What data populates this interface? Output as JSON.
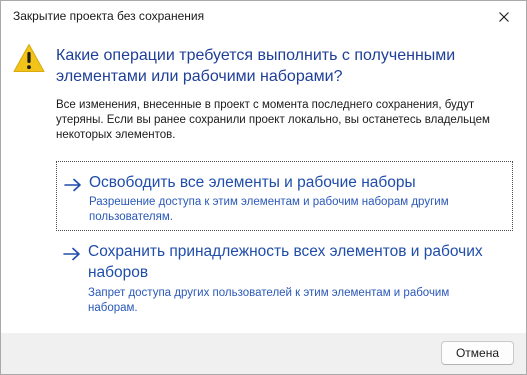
{
  "window": {
    "title": "Закрытие проекта без сохранения",
    "close_icon": "close-icon"
  },
  "dialog": {
    "icon": "warning-icon",
    "main_instruction": "Какие операции требуется выполнить с полученными элементами или рабочими наборами?",
    "content": "Все изменения, внесенные в проект с момента последнего сохранения, будут утеряны. Если вы ранее сохранили проект локально, вы останетесь владельцем некоторых элементов."
  },
  "commands": [
    {
      "title": "Освободить все элементы и рабочие наборы",
      "note": "Разрешение доступа к этим элементам и рабочим наборам другим пользователям."
    },
    {
      "title": "Сохранить принадлежность всех элементов и рабочих наборов",
      "note": "Запрет доступа других пользователей к этим элементам и рабочим наборам."
    }
  ],
  "footer": {
    "cancel_label": "Отмена"
  },
  "colors": {
    "instruction": "#1f3f99",
    "command_title": "#1f4dab",
    "warning_fill": "#f2c318",
    "footer_bg": "#f0f0f0"
  }
}
